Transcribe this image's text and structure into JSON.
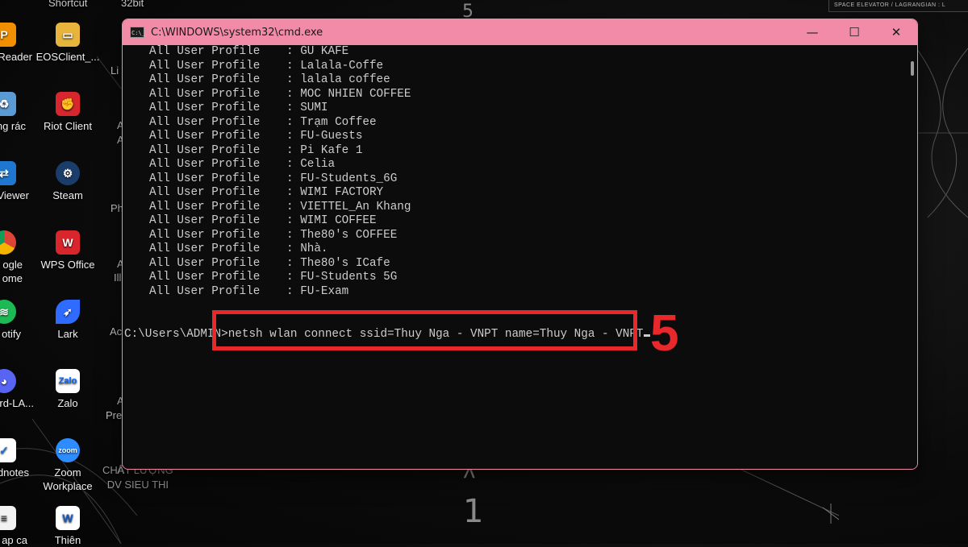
{
  "window": {
    "title": "C:\\WINDOWS\\system32\\cmd.exe",
    "app_icon_text": "C:\\_",
    "minimize_glyph": "—",
    "maximize_glyph": "☐",
    "close_glyph": "✕"
  },
  "console": {
    "profile_key": "All User Profile",
    "separator": ":",
    "profiles": [
      "GU KAFE",
      "Lalala-Coffe",
      "lalala coffee",
      "MOC NHIEN COFFEE",
      "SUMI",
      "Trạm Coffee",
      "FU-Guests",
      "Pi Kafe 1",
      "Celia",
      "FU-Students_6G",
      "WIMI FACTORY",
      "VIETTEL_An Khang",
      "WIMI COFFEE",
      "The80's COFFEE",
      "Nhà.",
      "The80's ICafe",
      "FU-Students 5G",
      "FU-Exam"
    ],
    "prompt": "C:\\Users\\ADMIN>",
    "command": "netsh wlan connect ssid=Thuy Nga - VNPT name=Thuy Nga - VNPT"
  },
  "annotation": {
    "step_number": "5",
    "color": "#e8282b"
  },
  "desktop": {
    "top_labels": [
      "Shortcut",
      "32bit"
    ],
    "icons_col1": [
      "Reader",
      "ng rác",
      "Viewer",
      "ogle\nome",
      "otify",
      "rd-LA...",
      "dnotes",
      "ap ca"
    ],
    "icons_col2": [
      {
        "label": "EOSClient_...",
        "icon": "folder-icon",
        "color": "#e7b43c"
      },
      {
        "label": "Riot Client",
        "icon": "riot-client-icon",
        "color": "#d7262e"
      },
      {
        "label": "Steam",
        "icon": "steam-icon",
        "color": "#1b3d6b"
      },
      {
        "label": "WPS Office",
        "icon": "wps-office-icon",
        "color": "#d8262c"
      },
      {
        "label": "Lark",
        "icon": "lark-icon",
        "color": "#2f6bff"
      },
      {
        "label": "Zalo",
        "icon": "zalo-icon",
        "color": "#ffffff"
      },
      {
        "label": "Zoom\nWorkplace",
        "icon": "zoom-icon",
        "color": "#2d8cff"
      },
      {
        "label": "Thiên",
        "icon": "word-doc-icon",
        "color": "#ffffff"
      }
    ],
    "col3_partials": [
      "Li",
      "A",
      "A",
      "Ph",
      "A",
      "Ill",
      "Ac",
      "A",
      "Pre",
      "A"
    ],
    "bottom_text": "CHẤT LƯỢNG\nDV SIEU THI",
    "wallpaper_chars": [
      "5",
      "λ",
      "1"
    ],
    "corner_text": "SPACE ELEVATOR / LAGRANGIAN : L"
  }
}
